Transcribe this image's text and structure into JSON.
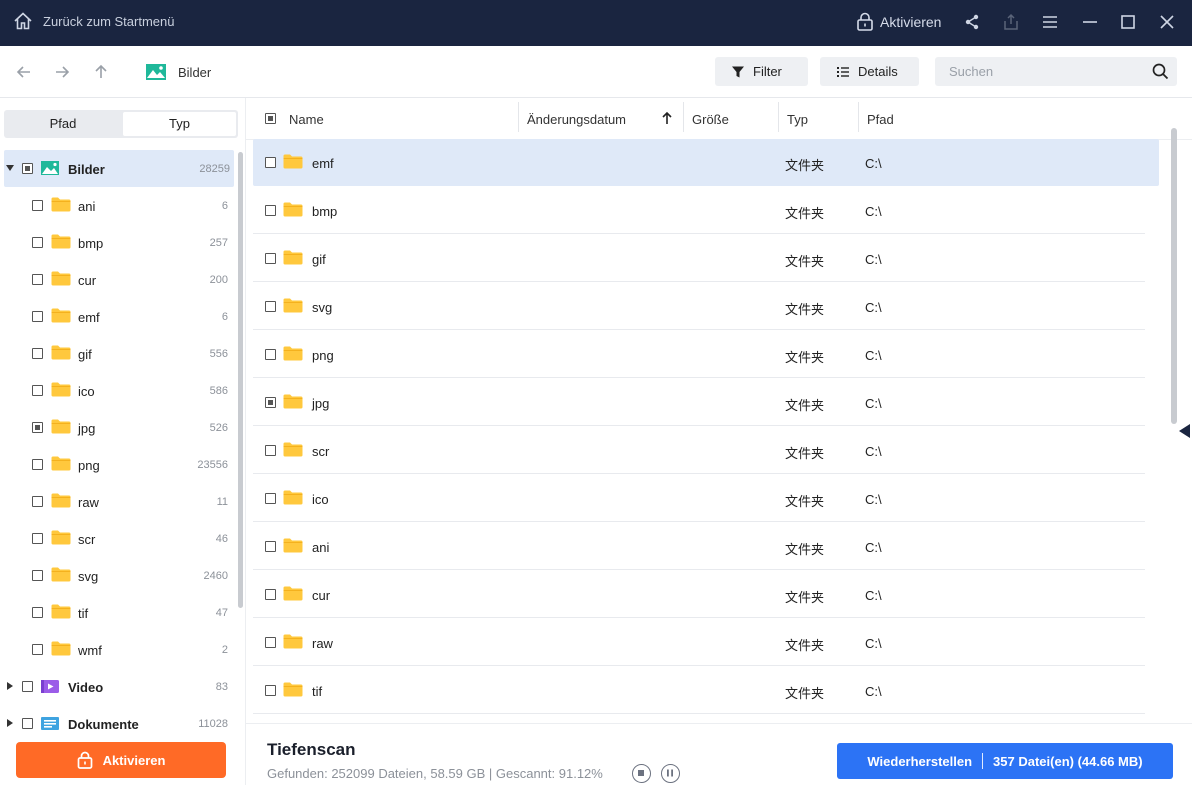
{
  "titlebar": {
    "back_label": "Zurück zum Startmenü",
    "activate_label": "Aktivieren"
  },
  "toolbar": {
    "breadcrumb": "Bilder",
    "filter_label": "Filter",
    "details_label": "Details",
    "search_placeholder": "Suchen"
  },
  "sidebar": {
    "tabs": [
      "Pfad",
      "Typ"
    ],
    "active_tab": "Typ",
    "root": {
      "label": "Bilder",
      "count": "28259",
      "checked": "partial"
    },
    "children": [
      {
        "label": "ani",
        "count": "6",
        "checked": "none"
      },
      {
        "label": "bmp",
        "count": "257",
        "checked": "none"
      },
      {
        "label": "cur",
        "count": "200",
        "checked": "none"
      },
      {
        "label": "emf",
        "count": "6",
        "checked": "none"
      },
      {
        "label": "gif",
        "count": "556",
        "checked": "none"
      },
      {
        "label": "ico",
        "count": "586",
        "checked": "none"
      },
      {
        "label": "jpg",
        "count": "526",
        "checked": "partial"
      },
      {
        "label": "png",
        "count": "23556",
        "checked": "none"
      },
      {
        "label": "raw",
        "count": "11",
        "checked": "none"
      },
      {
        "label": "scr",
        "count": "46",
        "checked": "none"
      },
      {
        "label": "svg",
        "count": "2460",
        "checked": "none"
      },
      {
        "label": "tif",
        "count": "47",
        "checked": "none"
      },
      {
        "label": "wmf",
        "count": "2",
        "checked": "none"
      }
    ],
    "siblings": [
      {
        "label": "Video",
        "count": "83"
      },
      {
        "label": "Dokumente",
        "count": "11028"
      }
    ],
    "activate_button": "Aktivieren"
  },
  "list": {
    "columns": {
      "name": "Name",
      "date": "Änderungsdatum",
      "size": "Größe",
      "type": "Typ",
      "path": "Pfad"
    },
    "rows": [
      {
        "name": "emf",
        "type": "文件夹",
        "path": "C:\\",
        "checked": "none",
        "selected": true
      },
      {
        "name": "bmp",
        "type": "文件夹",
        "path": "C:\\",
        "checked": "none"
      },
      {
        "name": "gif",
        "type": "文件夹",
        "path": "C:\\",
        "checked": "none"
      },
      {
        "name": "svg",
        "type": "文件夹",
        "path": "C:\\",
        "checked": "none"
      },
      {
        "name": "png",
        "type": "文件夹",
        "path": "C:\\",
        "checked": "none"
      },
      {
        "name": "jpg",
        "type": "文件夹",
        "path": "C:\\",
        "checked": "partial"
      },
      {
        "name": "scr",
        "type": "文件夹",
        "path": "C:\\",
        "checked": "none"
      },
      {
        "name": "ico",
        "type": "文件夹",
        "path": "C:\\",
        "checked": "none"
      },
      {
        "name": "ani",
        "type": "文件夹",
        "path": "C:\\",
        "checked": "none"
      },
      {
        "name": "cur",
        "type": "文件夹",
        "path": "C:\\",
        "checked": "none"
      },
      {
        "name": "raw",
        "type": "文件夹",
        "path": "C:\\",
        "checked": "none"
      },
      {
        "name": "tif",
        "type": "文件夹",
        "path": "C:\\",
        "checked": "none"
      }
    ]
  },
  "footer": {
    "title": "Tiefenscan",
    "status": "Gefunden: 252099 Dateien, 58.59 GB | Gescannt: 91.12%",
    "recover_label": "Wiederherstellen",
    "recover_info": "357 Datei(en) (44.66 MB)"
  },
  "colors": {
    "titlebar_bg": "#1a2540",
    "accent_orange": "#ff6a26",
    "accent_blue": "#2c73f5",
    "selection": "#dfe9f8",
    "folder": "#ffc83d"
  }
}
